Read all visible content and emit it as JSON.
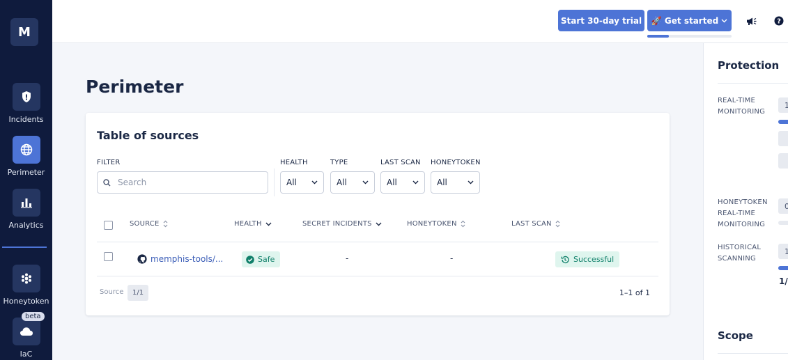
{
  "app": {
    "logo_letter": "M"
  },
  "sidebar": {
    "items": [
      {
        "label": "Incidents",
        "icon": "shield-icon"
      },
      {
        "label": "Perimeter",
        "icon": "globe-icon",
        "active": true
      },
      {
        "label": "Analytics",
        "icon": "bar-chart-icon"
      },
      {
        "label": "Honeytoken",
        "icon": "honeytoken-icon"
      },
      {
        "label": "IaC",
        "icon": "cloud-icon",
        "badge": "beta"
      }
    ]
  },
  "header": {
    "trial_button": "Start 30-day trial",
    "get_started_button": "🚀 Get started",
    "get_started_progress": 0.26,
    "icons": [
      "megaphone-icon",
      "help-icon"
    ]
  },
  "main": {
    "title": "Perimeter",
    "card_title": "Table of sources",
    "filters": {
      "filter_label": "FILTER",
      "search_placeholder": "Search",
      "health_label": "HEALTH",
      "health_value": "All",
      "type_label": "TYPE",
      "type_value": "All",
      "last_scan_label": "LAST SCAN",
      "last_scan_value": "All",
      "honeytoken_label": "HONEYTOKEN",
      "honeytoken_value": "All"
    },
    "table": {
      "columns": [
        "SOURCE",
        "HEALTH",
        "SECRET INCIDENTS",
        "HONEYTOKEN",
        "LAST SCAN"
      ],
      "rows": [
        {
          "source": "memphis-tools/...",
          "health": "Safe",
          "secret_incidents": "-",
          "honeytoken": "-",
          "last_scan": "Successful"
        }
      ]
    },
    "footer": {
      "label": "Source",
      "count": "1/1",
      "pagination": "1–1 of 1"
    }
  },
  "right_panel": {
    "protection_title": "Protection",
    "real_time_label": "REAL-TIME MONITORING",
    "real_time_value": "1",
    "honeytoken_label": "HONEYTOKEN REAL-TIME MONITORING",
    "honeytoken_value": "0",
    "historical_label": "HISTORICAL SCANNING",
    "historical_value": "1",
    "historical_fraction": "1/",
    "scope_title": "Scope"
  }
}
